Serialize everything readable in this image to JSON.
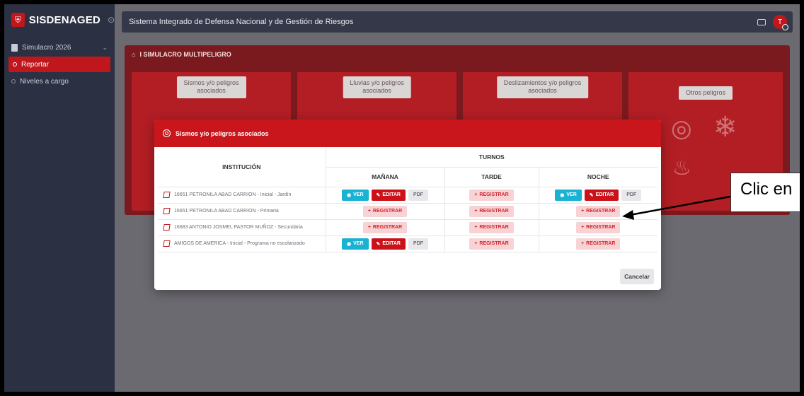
{
  "app": {
    "brand": "SISDENAGED",
    "header_title": "Sistema Integrado de Defensa Nacional y de Gestión de Riesgos",
    "avatar_initial": "T"
  },
  "sidebar": {
    "group": "Simulacro 2026",
    "items": [
      {
        "label": "Reportar",
        "active": true
      },
      {
        "label": "Niveles a cargo",
        "active": false
      }
    ]
  },
  "card": {
    "title": "I SIMULACRO MULTIPELIGRO",
    "tiles": [
      {
        "label_line1": "Sismos y/o peligros",
        "label_line2": "asociados"
      },
      {
        "label_line1": "Lluvias y/o peligros",
        "label_line2": "asociados"
      },
      {
        "label_line1": "Deslizamientos y/o peligros",
        "label_line2": "asociados"
      },
      {
        "label_line1": "Otros peligros",
        "label_line2": ""
      }
    ]
  },
  "modal": {
    "title": "Sismos y/o peligros asociados",
    "col_institucion": "INSTITUCIÓN",
    "col_turnos": "TURNOS",
    "shifts": [
      "MAÑANA",
      "TARDE",
      "NOCHE"
    ],
    "btn_ver": "VER",
    "btn_editar": "EDITAR",
    "btn_pdf": "PDF",
    "btn_registrar": "REGISTRAR",
    "cancel": "Cancelar",
    "rows": [
      {
        "institution": "16651 PETRONILA ABAD CARRION - Inicial - Jardín",
        "shifts": [
          "done",
          "register",
          "done"
        ]
      },
      {
        "institution": "16651 PETRONILA ABAD CARRION - Primaria",
        "shifts": [
          "register",
          "register",
          "register"
        ]
      },
      {
        "institution": "16683 ANTONIO JOSMEL PASTOR MUÑOZ - Secundaria",
        "shifts": [
          "register",
          "register",
          "register"
        ]
      },
      {
        "institution": "AMIGOS DE AMERICA - Inicial - Programa no escolarizado",
        "shifts": [
          "done",
          "register",
          "register"
        ]
      }
    ]
  },
  "annotation": {
    "text": "Clic en"
  },
  "colors": {
    "accent": "#c8161c",
    "sidebar": "#2b3142",
    "info": "#19b2d3"
  }
}
